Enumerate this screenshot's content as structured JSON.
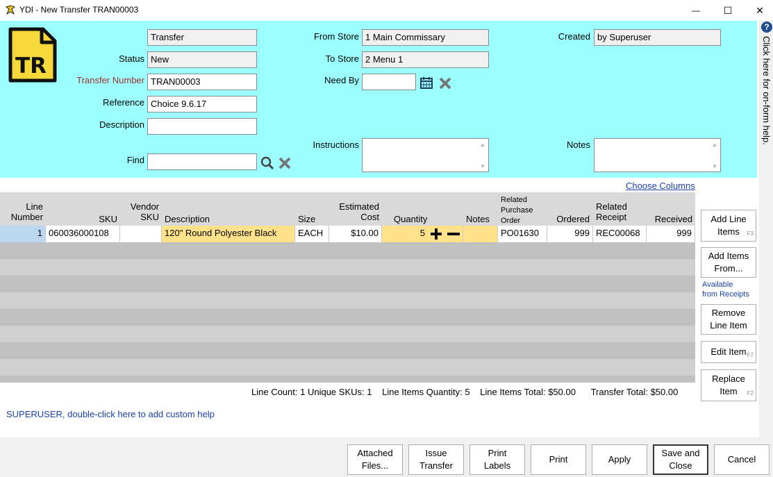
{
  "window": {
    "title": "YDI - New Transfer TRAN00003",
    "minimize": "—",
    "maximize": "☐",
    "close": "✕"
  },
  "header": {
    "doc_badge": "TR",
    "type_value": "Transfer",
    "status_label": "Status",
    "status_value": "New",
    "transfer_number_label": "Transfer Number",
    "transfer_number_value": "TRAN00003",
    "reference_label": "Reference",
    "reference_value": "Choice 9.6.17",
    "description_label": "Description",
    "description_value": "",
    "find_label": "Find",
    "find_value": "",
    "from_store_label": "From Store",
    "from_store_value": "1 Main Commissary",
    "to_store_label": "To Store",
    "to_store_value": "2 Menu 1",
    "need_by_label": "Need By",
    "need_by_value": "",
    "instructions_label": "Instructions",
    "created_label": "Created",
    "created_value": "by Superuser",
    "notes_label": "Notes"
  },
  "help_strip": {
    "icon": "?",
    "text": "Click here for on-form help."
  },
  "grid": {
    "choose_columns": "Choose Columns",
    "headers": {
      "line_number": [
        "Line",
        "Number"
      ],
      "sku": "SKU",
      "vendor_sku": [
        "Vendor",
        "SKU"
      ],
      "description": "Description",
      "size": "Size",
      "estimated_cost": [
        "Estimated",
        "Cost"
      ],
      "quantity": "Quantity",
      "notes": "Notes",
      "related_po": [
        "Related",
        "Purchase",
        "Order"
      ],
      "ordered": "Ordered",
      "related_receipt": [
        "Related",
        "Receipt"
      ],
      "received": "Received"
    },
    "rows": [
      {
        "line_number": "1",
        "sku": "060036000108",
        "vendor_sku": "",
        "description": "120\" Round Polyester Black",
        "size": "EACH",
        "estimated_cost": "$10.00",
        "quantity": "5",
        "notes": "",
        "related_po": "PO01630",
        "ordered": "999",
        "related_receipt": "REC00068",
        "received": "999"
      }
    ]
  },
  "side_buttons": {
    "add_line_items": [
      "Add Line",
      "Items"
    ],
    "add_line_items_key": "F3",
    "add_items_from": [
      "Add Items",
      "From..."
    ],
    "available_receipts": [
      "Available",
      "from Receipts"
    ],
    "remove_line_item": [
      "Remove",
      "Line Item"
    ],
    "edit_item": "Edit Item",
    "edit_item_key": "F7",
    "replace_item": [
      "Replace",
      "Item"
    ],
    "replace_item_key": "F2"
  },
  "summary": {
    "line_count": "Line Count: 1",
    "unique_skus": "Unique SKUs: 1",
    "line_items_quantity": "Line Items Quantity: 5",
    "line_items_total": "Line Items Total: $50.00",
    "transfer_total": "Transfer Total: $50.00"
  },
  "custom_help": "SUPERUSER, double-click here to add custom help",
  "bottom_buttons": {
    "attached_files": [
      "Attached",
      "Files..."
    ],
    "issue_transfer": [
      "Issue",
      "Transfer"
    ],
    "print_labels": [
      "Print",
      "Labels"
    ],
    "print": "Print",
    "apply": "Apply",
    "save_and_close": [
      "Save and",
      "Close"
    ],
    "cancel": "Cancel"
  },
  "colors": {
    "header_bg": "#9bffff",
    "badge_yellow": "#f5d93a",
    "editable_cell": "#ffe28a",
    "link_blue": "#1a3fa8",
    "label_red": "#a0302a"
  }
}
